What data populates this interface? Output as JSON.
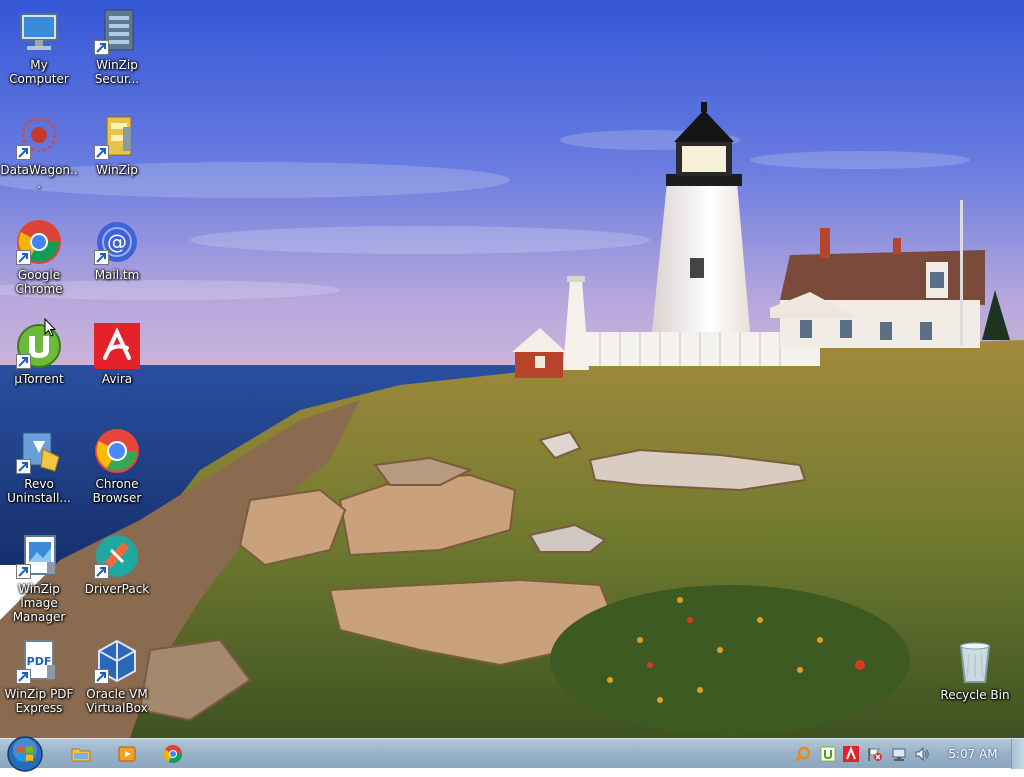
{
  "desktop": {
    "icons": [
      {
        "label": "My Computer",
        "icon": "computer-icon"
      },
      {
        "label": "WinZip Secur...",
        "icon": "winzip-secure-icon"
      },
      {
        "label": "DataWagon...",
        "icon": "datawagon-icon"
      },
      {
        "label": "WinZip",
        "icon": "winzip-icon"
      },
      {
        "label": "Google Chrome",
        "icon": "chrome-icon"
      },
      {
        "label": "Mail.tm",
        "icon": "mail-icon"
      },
      {
        "label": "µTorrent",
        "icon": "utorrent-icon"
      },
      {
        "label": "Avira",
        "icon": "avira-icon"
      },
      {
        "label": "Revo Uninstall...",
        "icon": "revo-uninstaller-icon"
      },
      {
        "label": "Chrone Browser",
        "icon": "chrone-browser-icon"
      },
      {
        "label": "WinZip Image Manager",
        "icon": "winzip-image-manager-icon"
      },
      {
        "label": "DriverPack",
        "icon": "driverpack-icon"
      },
      {
        "label": "WinZip PDF Express",
        "icon": "winzip-pdf-icon"
      },
      {
        "label": "Oracle VM VirtualBox",
        "icon": "virtualbox-icon"
      },
      {
        "label": "Recycle Bin",
        "icon": "recycle-bin-icon"
      }
    ]
  },
  "taskbar": {
    "start": "start-orb-icon",
    "pinned": [
      "file-explorer-icon",
      "media-player-icon",
      "chrome-icon"
    ],
    "tray": [
      "search-tray-icon",
      "utorrent-tray-icon",
      "avira-tray-icon",
      "action-center-icon",
      "network-icon",
      "volume-icon"
    ],
    "clock": "5:07 AM"
  },
  "colors": {
    "sky_top": "#3a5fd8",
    "sky_horizon": "#b9a9dc",
    "sea": "#1c3c8c",
    "grass": "#7a7a2e",
    "taskbar": "#9bb3c9"
  }
}
